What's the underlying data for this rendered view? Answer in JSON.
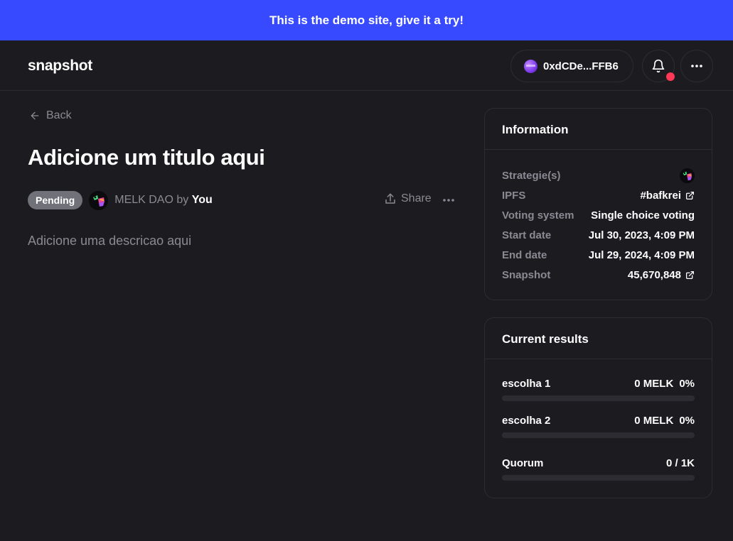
{
  "banner": {
    "text": "This is the demo site, give it a try!"
  },
  "navbar": {
    "brand": "snapshot",
    "account": "0xdCDe...FFB6"
  },
  "proposal": {
    "back_label": "Back",
    "title": "Adicione um titulo aqui",
    "status": "Pending",
    "space_name": "MELK DAO",
    "by_label": "by",
    "author": "You",
    "share_label": "Share",
    "description": "Adicione uma descricao aqui"
  },
  "information": {
    "header": "Information",
    "rows": [
      {
        "label": "Strategie(s)",
        "value": ""
      },
      {
        "label": "IPFS",
        "value": "#bafkrei"
      },
      {
        "label": "Voting system",
        "value": "Single choice voting"
      },
      {
        "label": "Start date",
        "value": "Jul 30, 2023, 4:09 PM"
      },
      {
        "label": "End date",
        "value": "Jul 29, 2024, 4:09 PM"
      },
      {
        "label": "Snapshot",
        "value": "45,670,848"
      }
    ]
  },
  "results": {
    "header": "Current results",
    "choices": [
      {
        "label": "escolha 1",
        "amount": "0 MELK",
        "percent": "0%",
        "fraction": 0
      },
      {
        "label": "escolha 2",
        "amount": "0 MELK",
        "percent": "0%",
        "fraction": 0
      }
    ],
    "quorum": {
      "label": "Quorum",
      "value": "0 / 1K",
      "fraction": 0
    }
  },
  "colors": {
    "background": "#1c1b20",
    "banner": "#384aff",
    "border": "#2d2c33",
    "muted_text": "#8b8a93",
    "badge_pending": "#71717a",
    "notification_dot": "#ff3856"
  },
  "icons": [
    "arrow-left-icon",
    "bell-icon",
    "more-horizontal-icon",
    "share-icon",
    "external-link-icon",
    "space-avatar-icon",
    "account-avatar-icon"
  ]
}
